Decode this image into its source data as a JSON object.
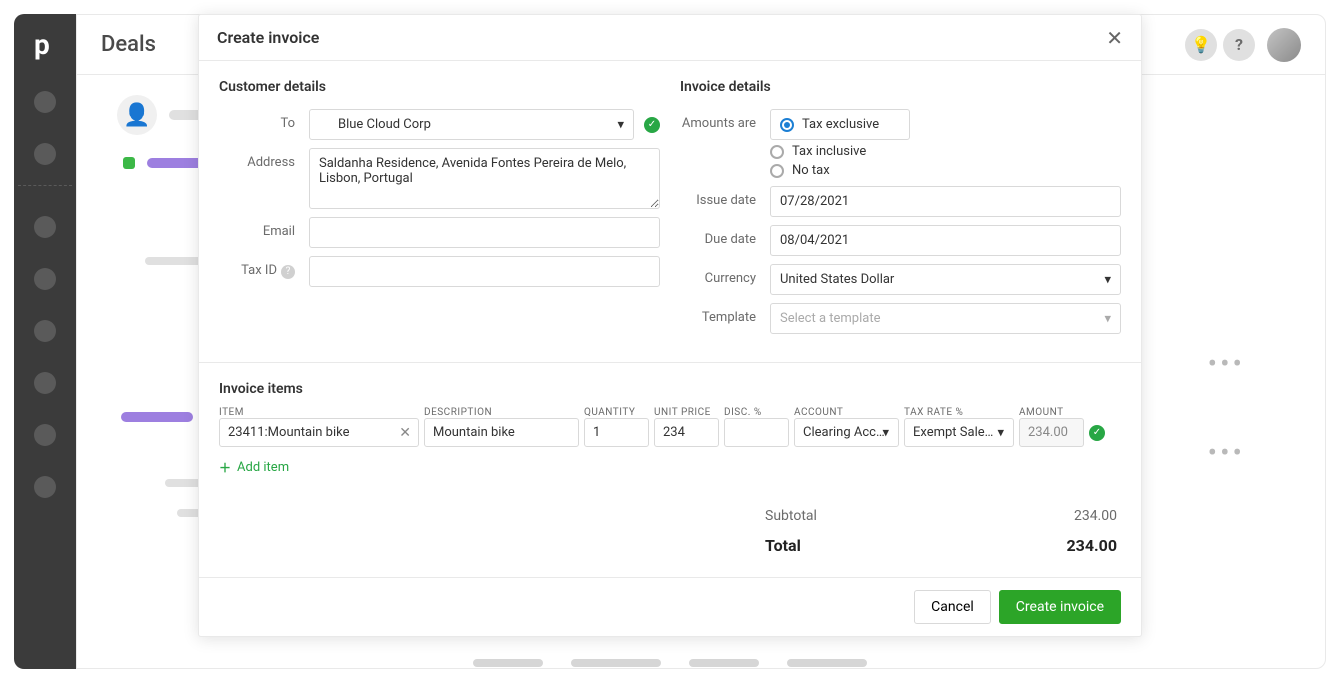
{
  "page": {
    "title": "Deals"
  },
  "modal": {
    "title": "Create invoice"
  },
  "customer": {
    "section_title": "Customer details",
    "to_label": "To",
    "to_value": "Blue Cloud Corp",
    "address_label": "Address",
    "address_value": "Saldanha Residence, Avenida Fontes Pereira de Melo, Lisbon, Portugal",
    "email_label": "Email",
    "email_value": "",
    "taxid_label": "Tax ID",
    "taxid_value": ""
  },
  "invoice": {
    "section_title": "Invoice details",
    "amounts_label": "Amounts are",
    "tax_options": [
      "Tax exclusive",
      "Tax inclusive",
      "No tax"
    ],
    "tax_selected": "Tax exclusive",
    "issue_date_label": "Issue date",
    "issue_date": "07/28/2021",
    "due_date_label": "Due date",
    "due_date": "08/04/2021",
    "currency_label": "Currency",
    "currency": "United States Dollar",
    "template_label": "Template",
    "template_placeholder": "Select a template"
  },
  "items": {
    "title": "Invoice items",
    "headers": {
      "item": "ITEM",
      "description": "DESCRIPTION",
      "quantity": "QUANTITY",
      "unit_price": "UNIT PRICE",
      "disc": "DISC. %",
      "account": "ACCOUNT",
      "tax_rate": "TAX RATE %",
      "amount": "AMOUNT"
    },
    "rows": [
      {
        "item": "23411:Mountain bike",
        "description": "Mountain bike",
        "quantity": "1",
        "unit_price": "234",
        "disc": "",
        "account": "Clearing Acc…",
        "tax_rate": "Exempt Sale…",
        "amount": "234.00"
      }
    ],
    "add_label": "Add item"
  },
  "totals": {
    "subtotal_label": "Subtotal",
    "subtotal_value": "234.00",
    "total_label": "Total",
    "total_value": "234.00"
  },
  "footer": {
    "cancel": "Cancel",
    "create": "Create invoice"
  }
}
